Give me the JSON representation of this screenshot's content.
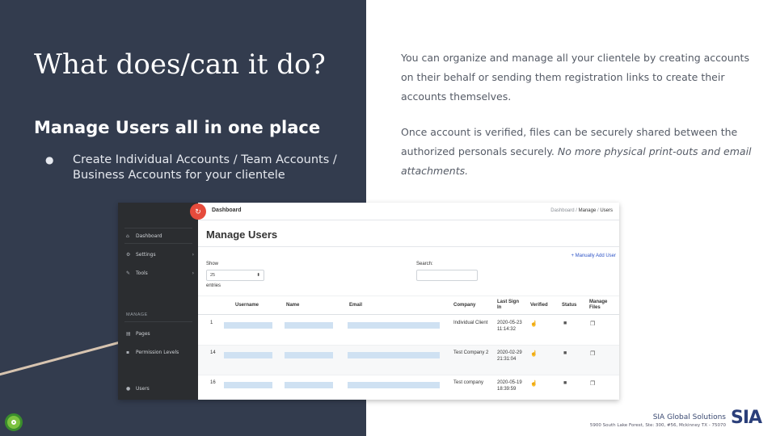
{
  "slide": {
    "title": "What does/can it do?",
    "subtitle": "Manage Users all in one place",
    "bullet": "Create Individual Accounts / Team Accounts / Business Accounts for your clientele",
    "paragraph1": "You can organize and manage all your clientele by creating accounts on their behalf or sending them registration links to create their accounts themselves.",
    "paragraph2_plain": "Once account is verified, files can be securely shared between the authorized personals securely. ",
    "paragraph2_italic": "No more physical print-outs and email attachments."
  },
  "footer": {
    "company": "SIA Global Solutions",
    "address": "5900 South Lake Forest, Ste: 300, #56, Mckinney TX - 75070",
    "logo_text": "SIA"
  },
  "app": {
    "topbar_title": "Dashboard",
    "breadcrumbs": [
      "Dashboard",
      "Manage",
      "Users"
    ],
    "sidebar": {
      "items": [
        {
          "label": "Dashboard",
          "icon": "home-icon"
        },
        {
          "label": "Settings",
          "icon": "gear-icon"
        },
        {
          "label": "Tools",
          "icon": "wrench-icon"
        }
      ],
      "section_label": "MANAGE",
      "manage_items": [
        {
          "label": "Pages",
          "icon": "page-icon"
        },
        {
          "label": "Permission Levels",
          "icon": "lock-icon"
        },
        {
          "label": "Users",
          "icon": "user-icon"
        }
      ]
    },
    "page_title": "Manage Users",
    "add_user_label": "+ Manually Add User",
    "show_label": "Show",
    "show_value": "25",
    "entries_label": "entries",
    "search_label": "Search:",
    "columns": [
      "Username",
      "Name",
      "Email",
      "Company",
      "Last Sign In",
      "Verified",
      "Status",
      "Manage Files"
    ],
    "rows": [
      {
        "id": "1",
        "company": "Individual Client",
        "last_sign_in": "2020-05-23 11:14:32"
      },
      {
        "id": "14",
        "company": "Test Company 2",
        "last_sign_in": "2020-02-29 21:31:04"
      },
      {
        "id": "16",
        "company": "Test company",
        "last_sign_in": "2020-05-19 18:39:59"
      }
    ]
  },
  "colors": {
    "left_panel": "#333c4e",
    "sidebar": "#2b2d30",
    "accent_red": "#e64b3c",
    "link_blue": "#2f55c7"
  }
}
